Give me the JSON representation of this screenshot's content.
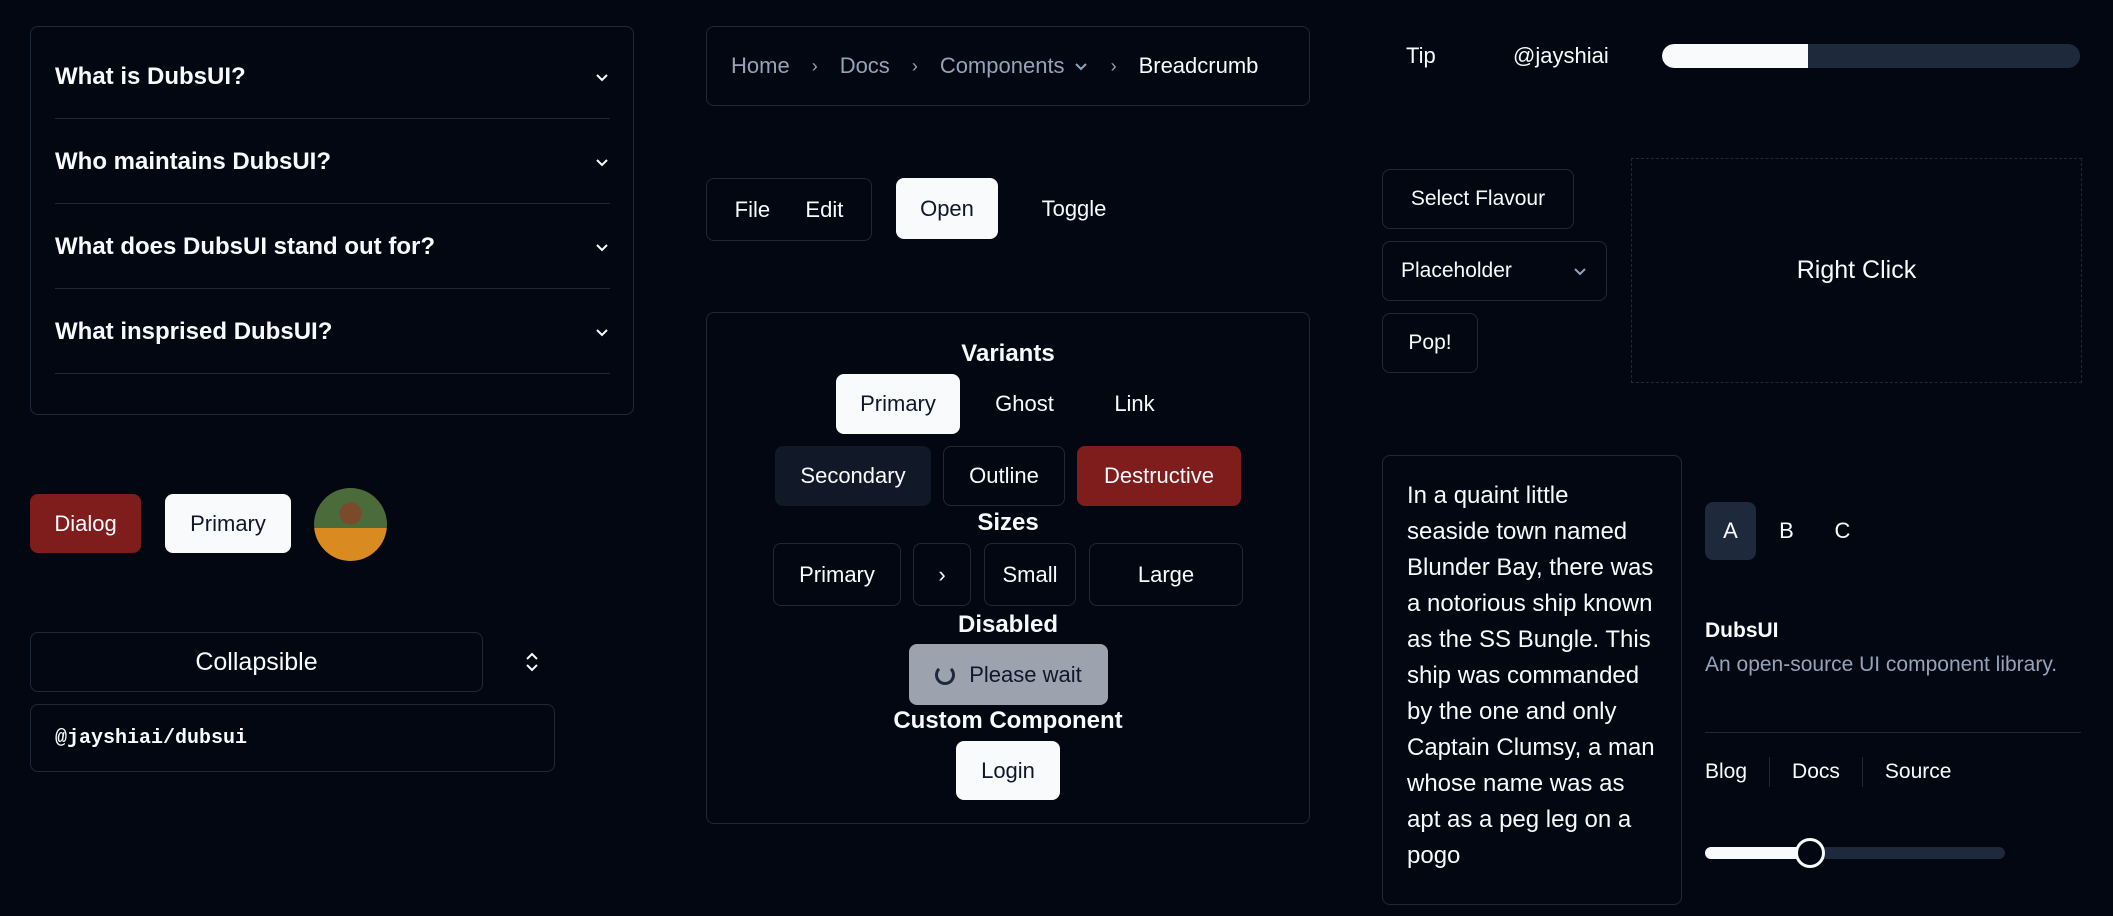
{
  "accordion": {
    "items": [
      {
        "label": "What is DubsUI?"
      },
      {
        "label": "Who maintains DubsUI?"
      },
      {
        "label": "What does DubsUI stand out for?"
      },
      {
        "label": "What insprised DubsUI?"
      }
    ]
  },
  "breadcrumb": {
    "items": [
      "Home",
      "Docs",
      "Components"
    ],
    "current": "Breadcrumb",
    "separator": "›"
  },
  "menubar": {
    "items": [
      "File",
      "Edit"
    ]
  },
  "open_button": "Open",
  "toggle_button": "Toggle",
  "variants": {
    "title": "Variants",
    "primary": "Primary",
    "ghost": "Ghost",
    "link": "Link",
    "secondary": "Secondary",
    "outline": "Outline",
    "destructive": "Destructive"
  },
  "sizes": {
    "title": "Sizes",
    "primary": "Primary",
    "icon": "›",
    "small": "Small",
    "large": "Large"
  },
  "disabled": {
    "title": "Disabled",
    "label": "Please wait"
  },
  "custom": {
    "title": "Custom Component",
    "login": "Login"
  },
  "dialog_button": "Dialog",
  "primary_button": "Primary",
  "collapsible": {
    "label": "Collapsible",
    "content": "@jayshiai/dubsui"
  },
  "tip": {
    "label": "Tip",
    "handle": "@jayshiai",
    "progress_fraction": 0.35
  },
  "select_flavour": "Select Flavour",
  "select": {
    "placeholder": "Placeholder"
  },
  "pop_button": "Pop!",
  "right_click": "Right Click",
  "textarea": {
    "value": "In a quaint little seaside town named Blunder Bay, there was a notorious ship known as the SS Bungle. This ship was commanded by the one and only Captain Clumsy, a man whose name was as apt as a peg leg on a pogo"
  },
  "toggle_group": {
    "items": [
      "A",
      "B",
      "C"
    ],
    "selected": "A"
  },
  "card": {
    "title": "DubsUI",
    "description": "An open-source UI component library.",
    "links": [
      "Blog",
      "Docs",
      "Source"
    ]
  },
  "slider": {
    "value_fraction": 0.35
  },
  "colors": {
    "background": "#030712",
    "border": "#1f2937",
    "destructive": "#7f1d1d",
    "secondary": "#111827",
    "muted_text": "#94a3b8"
  }
}
